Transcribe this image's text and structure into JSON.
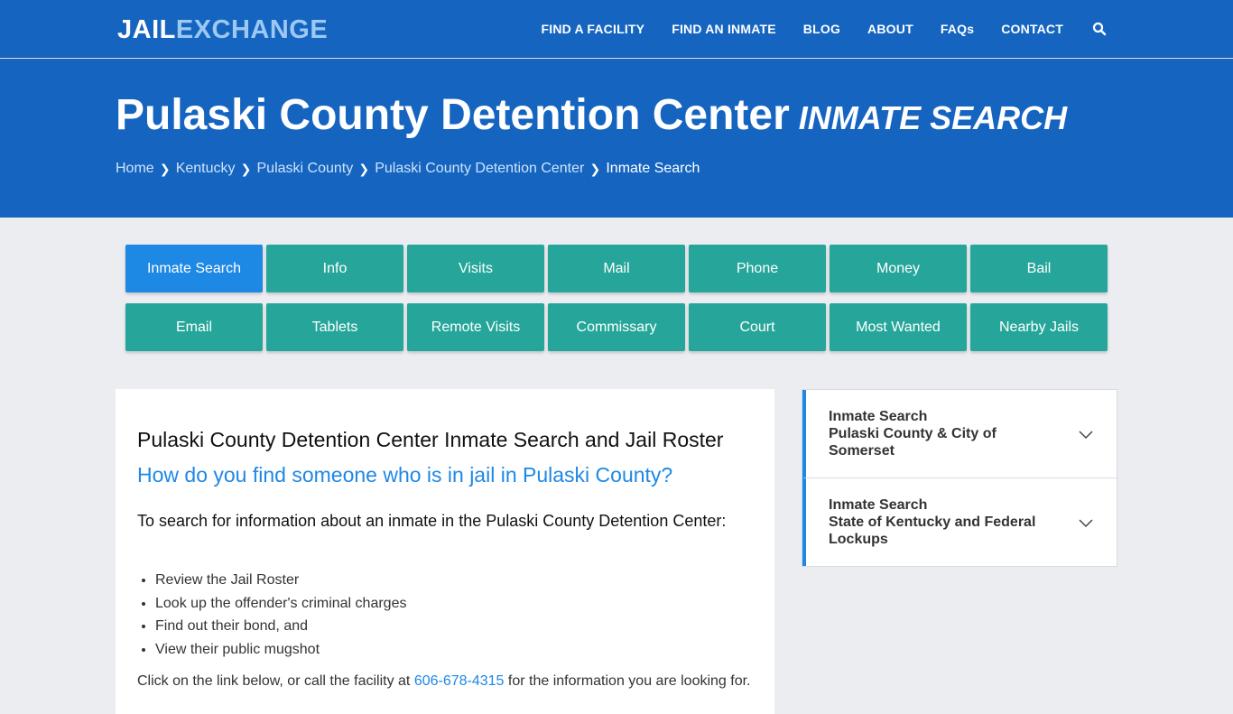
{
  "logo": {
    "part1": "JAIL",
    "part2": "EXCHANGE"
  },
  "nav": [
    "FIND A FACILITY",
    "FIND AN INMATE",
    "BLOG",
    "ABOUT",
    "FAQs",
    "CONTACT"
  ],
  "hero": {
    "title": "Pulaski County Detention Center",
    "subtitle": "INMATE SEARCH",
    "breadcrumbs": [
      "Home",
      "Kentucky",
      "Pulaski County",
      "Pulaski County Detention Center"
    ],
    "current": "Inmate Search"
  },
  "tabs": [
    "Inmate Search",
    "Info",
    "Visits",
    "Mail",
    "Phone",
    "Money",
    "Bail",
    "Email",
    "Tablets",
    "Remote Visits",
    "Commissary",
    "Court",
    "Most Wanted",
    "Nearby Jails"
  ],
  "main": {
    "heading": "Pulaski County Detention Center Inmate Search and Jail Roster",
    "question": "How do you find someone who is in jail in Pulaski County?",
    "intro": "To search for information about an inmate in the Pulaski County Detention Center:",
    "bullets": [
      "Review the Jail Roster",
      "Look up the offender's criminal charges",
      "Find out their bond, and",
      "View their public mugshot"
    ],
    "para_before": "Click on the link below, or call the facility at ",
    "phone": "606-678-4315",
    "para_after": " for the information you are looking for."
  },
  "sidebar": [
    {
      "line1": "Inmate Search",
      "line2": "Pulaski County & City of Somerset"
    },
    {
      "line1": "Inmate Search",
      "line2": "State of Kentucky and Federal Lockups"
    }
  ],
  "colors": {
    "primary": "#1565c0",
    "teal": "#26a69a",
    "accent": "#1e88e5"
  }
}
